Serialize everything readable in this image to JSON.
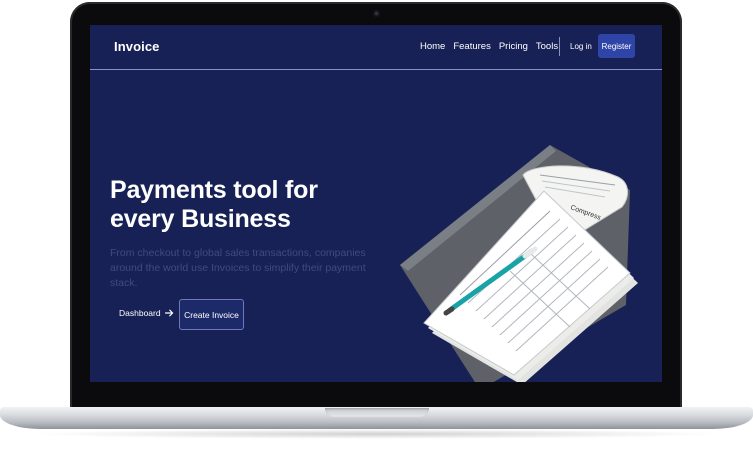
{
  "app": {
    "brand": "Invoice"
  },
  "nav": {
    "links": [
      "Home",
      "Features",
      "Pricing",
      "Tools"
    ],
    "login": "Log in",
    "register": "Register"
  },
  "hero": {
    "title": "Payments tool for every Business",
    "subtitle": "From checkout to global sales transactions, companies around the world use Invoices to simplify their payment stack.",
    "dashboard_label": "Dashboard",
    "dashboard_icon": "arrow-right-icon",
    "create_label": "Create Invoice"
  },
  "illustration": {
    "pad_brand": "Compress"
  },
  "colors": {
    "screen_bg": "#172155",
    "register_bg": "#2f44a7",
    "subtitle_text": "#3f4b80"
  }
}
